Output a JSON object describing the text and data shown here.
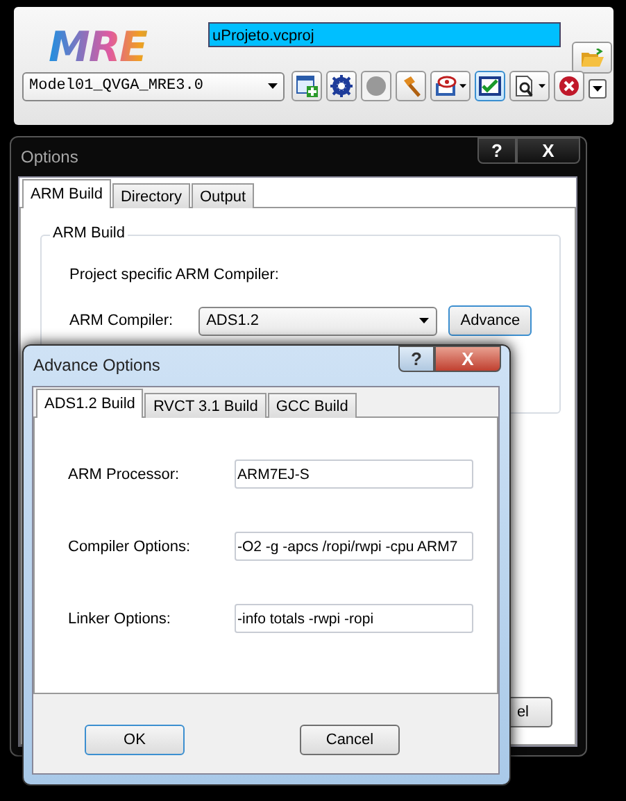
{
  "toolbar": {
    "logo": "MRE",
    "project_file": "uProjeto.vcproj",
    "model": "Model01_QVGA_MRE3.0",
    "tools": [
      {
        "kind": "add",
        "has_menu": false,
        "pressed": false,
        "disabled": false
      },
      {
        "kind": "gear",
        "has_menu": false,
        "pressed": false,
        "disabled": false
      },
      {
        "kind": "record",
        "has_menu": false,
        "pressed": false,
        "disabled": true
      },
      {
        "kind": "hammer",
        "has_menu": false,
        "pressed": false,
        "disabled": false
      },
      {
        "kind": "eye",
        "has_menu": true,
        "pressed": false,
        "disabled": false
      },
      {
        "kind": "check",
        "has_menu": false,
        "pressed": true,
        "disabled": false
      },
      {
        "kind": "preview",
        "has_menu": true,
        "pressed": false,
        "disabled": false
      },
      {
        "kind": "stop",
        "has_menu": false,
        "pressed": false,
        "disabled": false
      }
    ]
  },
  "options_window": {
    "title": "Options",
    "title_buttons": [
      "?",
      "X"
    ],
    "tabs": [
      {
        "label": "ARM Build",
        "selected": true
      },
      {
        "label": "Directory",
        "selected": false
      },
      {
        "label": "Output",
        "selected": false
      }
    ],
    "group_title": "ARM Build",
    "note": "Project specific ARM Compiler:",
    "compiler_label": "ARM Compiler:",
    "compiler_value": "ADS1.2",
    "advance_button": "Advance",
    "cancel_button_visible": "el"
  },
  "advance_dialog": {
    "title": "Advance Options",
    "title_buttons": [
      "?",
      "X"
    ],
    "tabs": [
      {
        "label": "ADS1.2 Build",
        "selected": true
      },
      {
        "label": "RVCT 3.1 Build",
        "selected": false
      },
      {
        "label": "GCC Build",
        "selected": false
      }
    ],
    "fields": [
      {
        "label": "ARM Processor:",
        "value": "ARM7EJ-S"
      },
      {
        "label": "Compiler Options:",
        "value": "-O2 -g -apcs /ropi/rwpi -cpu ARM7"
      },
      {
        "label": "Linker Options:",
        "value": "-info totals -rwpi -ropi"
      }
    ],
    "buttons": [
      {
        "label": "OK",
        "default": true
      },
      {
        "label": "Cancel",
        "default": false
      }
    ]
  }
}
